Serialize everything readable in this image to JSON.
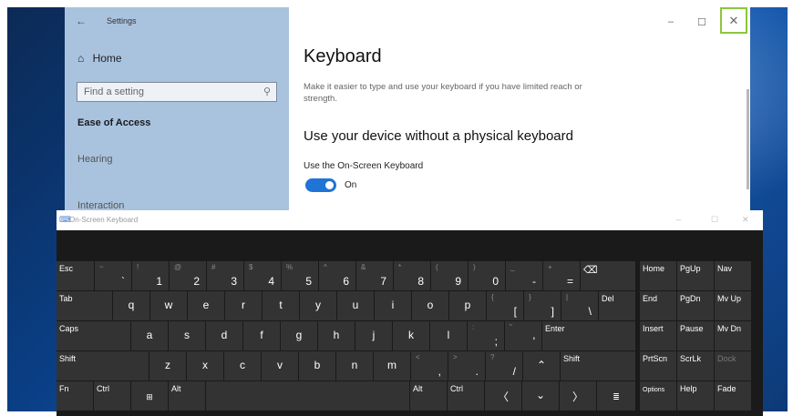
{
  "settings": {
    "app_title": "Settings",
    "home": "Home",
    "search_placeholder": "Find a setting",
    "section": "Ease of Access",
    "nav_items": [
      "Hearing",
      "Interaction"
    ],
    "page_title": "Keyboard",
    "description": "Make it easier to type and use your keyboard if you have limited reach or strength.",
    "subheading": "Use your device without a physical keyboard",
    "osk_label": "Use the On-Screen Keyboard",
    "osk_toggle_state": "On"
  },
  "osk": {
    "title": "On-Screen Keyboard",
    "keys": {
      "esc": "Esc",
      "tilde_s": "~",
      "tilde_p": "`",
      "k1_s": "!",
      "k1_p": "1",
      "k2_s": "@",
      "k2_p": "2",
      "k3_s": "#",
      "k3_p": "3",
      "k4_s": "$",
      "k4_p": "4",
      "k5_s": "%",
      "k5_p": "5",
      "k6_s": "^",
      "k6_p": "6",
      "k7_s": "&",
      "k7_p": "7",
      "k8_s": "*",
      "k8_p": "8",
      "k9_s": "(",
      "k9_p": "9",
      "k0_s": ")",
      "k0_p": "0",
      "minus_s": "_",
      "minus_p": "-",
      "eq_s": "+",
      "eq_p": "=",
      "backspace": "⌫",
      "tab": "Tab",
      "q": "q",
      "w": "w",
      "e": "e",
      "r": "r",
      "t": "t",
      "y": "y",
      "u": "u",
      "i": "i",
      "o": "o",
      "p": "p",
      "lbr_s": "{",
      "lbr_p": "[",
      "rbr_s": "}",
      "rbr_p": "]",
      "bsl_s": "|",
      "bsl_p": "\\",
      "del": "Del",
      "caps": "Caps",
      "a": "a",
      "s": "s",
      "d": "d",
      "f": "f",
      "g": "g",
      "h": "h",
      "j": "j",
      "k": "k",
      "l": "l",
      "semi_s": ":",
      "semi_p": ";",
      "quote_s": "\"",
      "quote_p": "'",
      "enter": "Enter",
      "shift_l": "Shift",
      "z": "z",
      "x": "x",
      "c": "c",
      "v": "v",
      "b": "b",
      "n": "n",
      "m": "m",
      "comma_s": "<",
      "comma_p": ",",
      "period_s": ">",
      "period_p": ".",
      "slash_s": "?",
      "slash_p": "/",
      "up": "⌃",
      "shift_r": "Shift",
      "fn": "Fn",
      "ctrl_l": "Ctrl",
      "win": "⊞",
      "alt_l": "Alt",
      "alt_r": "Alt",
      "ctrl_r": "Ctrl",
      "left": "〈",
      "down": "⌄",
      "right": "〉",
      "menu": "≣",
      "home": "Home",
      "pgup": "PgUp",
      "nav": "Nav",
      "end": "End",
      "pgdn": "PgDn",
      "mvup": "Mv Up",
      "insert": "Insert",
      "pause": "Pause",
      "mvdn": "Mv Dn",
      "prtscn": "PrtScn",
      "scrlk": "ScrLk",
      "dock": "Dock",
      "options": "Options",
      "help": "Help",
      "fade": "Fade"
    }
  }
}
